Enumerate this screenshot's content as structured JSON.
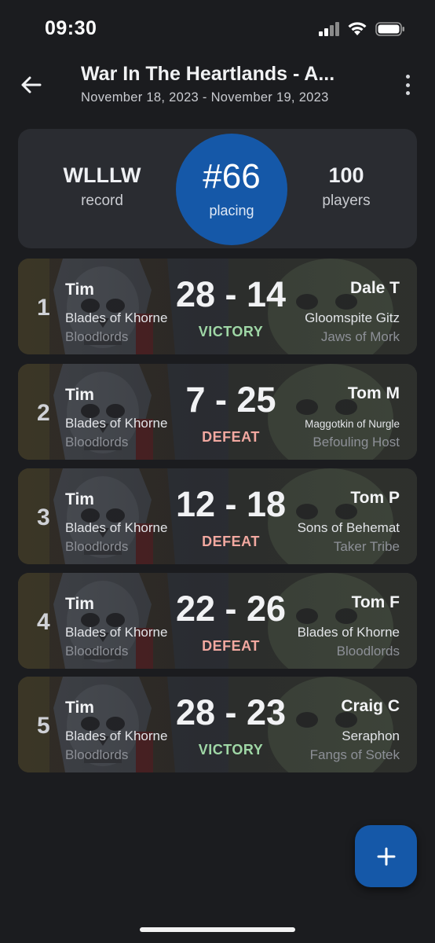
{
  "status": {
    "time": "09:30"
  },
  "header": {
    "title": "War In The Heartlands - A...",
    "dates": "November 18, 2023 - November 19, 2023"
  },
  "summary": {
    "record_value": "WLLLW",
    "record_label": "record",
    "placing_value": "#66",
    "placing_label": "placing",
    "players_value": "100",
    "players_label": "players"
  },
  "matches": [
    {
      "round": "1",
      "player": "Tim",
      "army": "Blades of Khorne",
      "subfaction": "Bloodlords",
      "score": "28 - 14",
      "result": "VICTORY",
      "opponent": "Dale T",
      "opp_army": "Gloomspite Gitz",
      "opp_subfaction": "Jaws of Mork"
    },
    {
      "round": "2",
      "player": "Tim",
      "army": "Blades of Khorne",
      "subfaction": "Bloodlords",
      "score": "7 - 25",
      "result": "DEFEAT",
      "opponent": "Tom M",
      "opp_army": "Maggotkin of Nurgle",
      "opp_subfaction": "Befouling Host"
    },
    {
      "round": "3",
      "player": "Tim",
      "army": "Blades of Khorne",
      "subfaction": "Bloodlords",
      "score": "12 - 18",
      "result": "DEFEAT",
      "opponent": "Tom P",
      "opp_army": "Sons of Behemat",
      "opp_subfaction": "Taker Tribe"
    },
    {
      "round": "4",
      "player": "Tim",
      "army": "Blades of Khorne",
      "subfaction": "Bloodlords",
      "score": "22 - 26",
      "result": "DEFEAT",
      "opponent": "Tom F",
      "opp_army": "Blades of Khorne",
      "opp_subfaction": "Bloodlords"
    },
    {
      "round": "5",
      "player": "Tim",
      "army": "Blades of Khorne",
      "subfaction": "Bloodlords",
      "score": "28 - 23",
      "result": "VICTORY",
      "opponent": "Craig C",
      "opp_army": "Seraphon",
      "opp_subfaction": "Fangs of Sotek"
    }
  ],
  "fab": {
    "label": "+"
  },
  "icons": {
    "back": "arrow-left-icon",
    "more": "more-vertical-icon",
    "add": "plus-icon"
  },
  "colors": {
    "background": "#1b1c1f",
    "card": "#2a2c31",
    "accent": "#1558a8",
    "victory": "#9fd7a6",
    "defeat": "#f2a8a0"
  }
}
